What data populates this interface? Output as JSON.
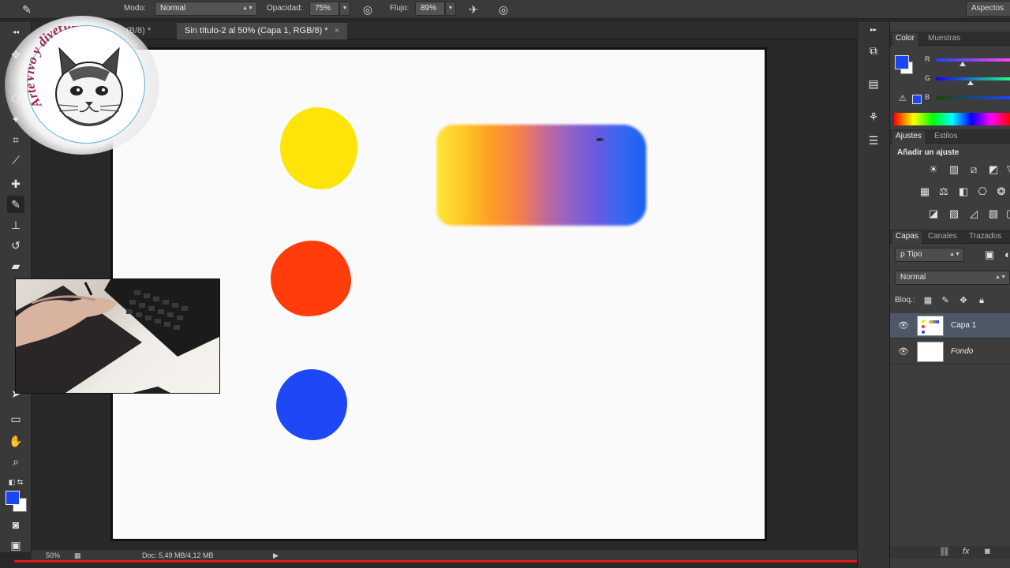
{
  "options_bar": {
    "mode_label": "Modo:",
    "mode_value": "Normal",
    "opacity_label": "Opacidad:",
    "opacity_value": "75%",
    "flow_label": "Flujo:",
    "flow_value": "89%",
    "workspace_label": "Aspectos"
  },
  "tabs": [
    {
      "label": "(B/8) *",
      "closeable": false
    },
    {
      "label": "Sin título-2 al 50% (Capa 1, RGB/8) *",
      "close": "×"
    }
  ],
  "logo": {
    "text": "ArteVivo y divertido",
    "icon": "cat-logo-icon"
  },
  "colors": {
    "foreground": "#1a47f2",
    "background": "#ffffff",
    "blob_yellow": "#ffe40a",
    "blob_red": "#ff3c0a",
    "blob_blue": "#1e48f5",
    "status_accent": "#e0161d"
  },
  "status_bar": {
    "zoom": "50%",
    "doc_info": "Doc: 5,49 MB/4,12 MB"
  },
  "color_panel": {
    "tabs": [
      "Color",
      "Muestras"
    ],
    "channels": [
      {
        "name": "R",
        "value": 0.3
      },
      {
        "name": "G",
        "value": 0.46
      },
      {
        "name": "B",
        "value": 0.0
      }
    ]
  },
  "adjustments_panel": {
    "tabs": [
      "Ajustes",
      "Estilos"
    ],
    "title": "Añadir un ajuste"
  },
  "layers_panel": {
    "tabs": [
      "Capas",
      "Canales",
      "Trazados"
    ],
    "filter_label": "ρ Tipo",
    "blend_mode": "Normal",
    "lock_label": "Bloq.:",
    "layers": [
      {
        "name": "Capa 1",
        "selected": true
      },
      {
        "name": "Fondo",
        "selected": false
      }
    ]
  }
}
